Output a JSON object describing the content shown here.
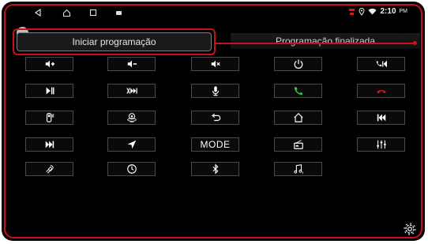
{
  "status": {
    "time": "2:10",
    "ampm": "PM"
  },
  "buttons": {
    "start": "Iniciar programação"
  },
  "labels": {
    "finished": "Programação finalizada"
  },
  "keys": {
    "mode": "MODE"
  },
  "colors": {
    "accent": "#c8111b",
    "call_green": "#2ecc40",
    "hangup_red": "#e0141e"
  },
  "icons": [
    "volume-up-icon",
    "volume-down-icon",
    "mute-icon",
    "power-icon",
    "call-prev-icon",
    "play-pause-icon",
    "cancel-next-icon",
    "mic-icon",
    "answer-call-icon",
    "hang-up-icon",
    "car-door-icon",
    "camera-360-icon",
    "back-icon",
    "home-icon",
    "prev-track-icon",
    "next-track-icon",
    "navigation-icon",
    "mode-label",
    "radio-icon",
    "equalizer-icon",
    "satellite-icon",
    "clock-icon",
    "bluetooth-icon",
    "music-icon",
    "settings-icon"
  ]
}
